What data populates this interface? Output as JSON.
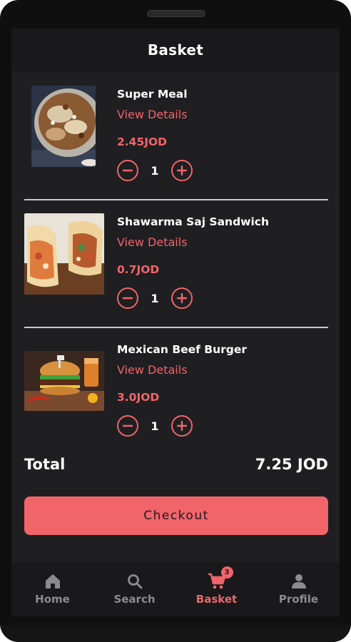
{
  "header": {
    "title": "Basket"
  },
  "items": [
    {
      "name": "Super Meal",
      "details_label": "View Details",
      "price": "2.45JOD",
      "quantity": "1"
    },
    {
      "name": "Shawarma Saj Sandwich",
      "details_label": "View Details",
      "price": "0.7JOD",
      "quantity": "1"
    },
    {
      "name": "Mexican Beef Burger",
      "details_label": "View Details",
      "price": "3.0JOD",
      "quantity": "1"
    }
  ],
  "total": {
    "label": "Total",
    "value": "7.25 JOD"
  },
  "checkout": {
    "label": "Checkout"
  },
  "nav": {
    "items": [
      {
        "label": "Home",
        "icon": "home-icon"
      },
      {
        "label": "Search",
        "icon": "search-icon"
      },
      {
        "label": "Basket",
        "icon": "cart-icon",
        "badge": "3",
        "active": true
      },
      {
        "label": "Profile",
        "icon": "person-icon"
      }
    ]
  },
  "colors": {
    "accent": "#f0646a",
    "background": "#1f1f21",
    "bar": "#19191b",
    "inactive": "#8b8b8f"
  }
}
